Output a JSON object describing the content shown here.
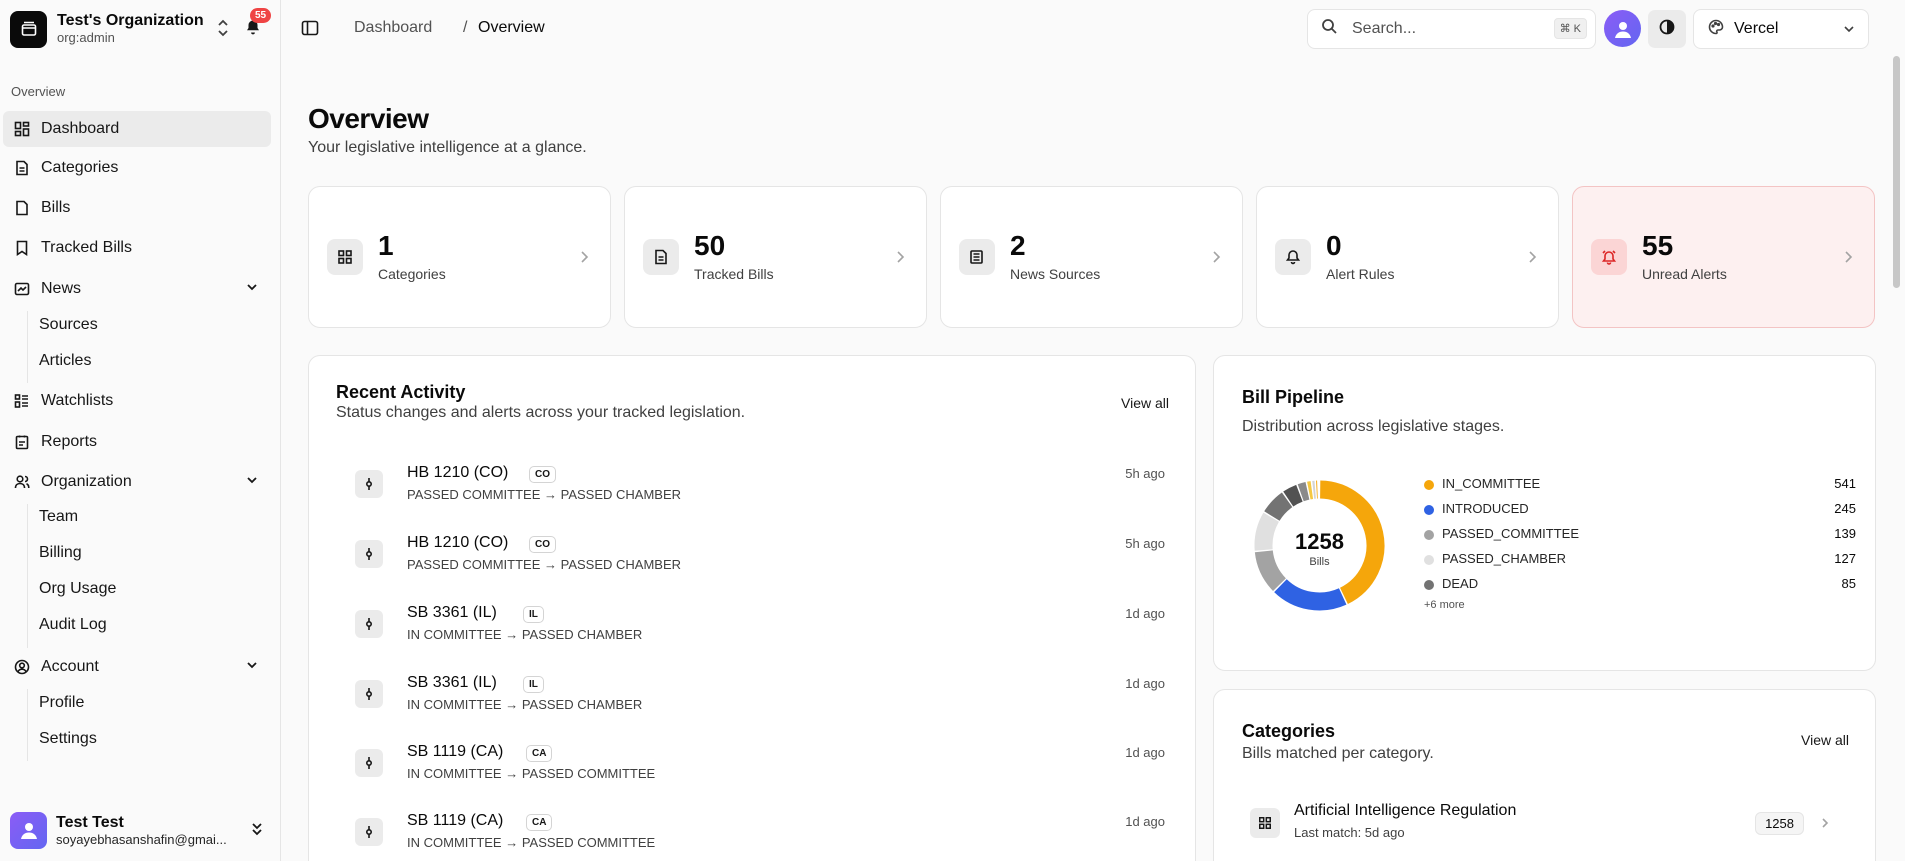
{
  "org": {
    "name": "Test's Organization",
    "role": "org:admin",
    "notifications": "55"
  },
  "sidebar": {
    "section": "Overview",
    "items": [
      {
        "label": "Dashboard",
        "icon": "dashboard-icon"
      },
      {
        "label": "Categories",
        "icon": "document-icon"
      },
      {
        "label": "Bills",
        "icon": "file-icon"
      },
      {
        "label": "Tracked Bills",
        "icon": "bookmark-icon"
      },
      {
        "label": "News",
        "icon": "newspaper-icon"
      },
      {
        "label": "Watchlists",
        "icon": "watchlist-icon"
      },
      {
        "label": "Reports",
        "icon": "report-icon"
      },
      {
        "label": "Organization",
        "icon": "users-icon"
      },
      {
        "label": "Account",
        "icon": "user-circle-icon"
      }
    ],
    "news_sub": [
      "Sources",
      "Articles"
    ],
    "org_sub": [
      "Team",
      "Billing",
      "Org Usage",
      "Audit Log"
    ],
    "account_sub": [
      "Profile",
      "Settings"
    ]
  },
  "user": {
    "name": "Test Test",
    "email": "soyayebhasanshafin@gmai..."
  },
  "header": {
    "breadcrumb": [
      "Dashboard",
      "Overview"
    ],
    "search_placeholder": "Search...",
    "shortcut": "⌘ K",
    "project": "Vercel"
  },
  "page": {
    "title": "Overview",
    "subtitle": "Your legislative intelligence at a glance."
  },
  "stats": [
    {
      "value": "1",
      "label": "Categories",
      "icon": "grid-icon"
    },
    {
      "value": "50",
      "label": "Tracked Bills",
      "icon": "document-icon"
    },
    {
      "value": "2",
      "label": "News Sources",
      "icon": "newspaper-icon"
    },
    {
      "value": "0",
      "label": "Alert Rules",
      "icon": "bell-icon"
    },
    {
      "value": "55",
      "label": "Unread Alerts",
      "icon": "alarm-icon"
    }
  ],
  "activity": {
    "title": "Recent Activity",
    "subtitle": "Status changes and alerts across your tracked legislation.",
    "view_all": "View all",
    "items": [
      {
        "title": "HB 1210 (CO)",
        "badge": "CO",
        "status": "PASSED COMMITTEE → PASSED CHAMBER",
        "time": "5h ago"
      },
      {
        "title": "HB 1210 (CO)",
        "badge": "CO",
        "status": "PASSED COMMITTEE → PASSED CHAMBER",
        "time": "5h ago"
      },
      {
        "title": "SB 3361 (IL)",
        "badge": "IL",
        "status": "IN COMMITTEE → PASSED CHAMBER",
        "time": "1d ago"
      },
      {
        "title": "SB 3361 (IL)",
        "badge": "IL",
        "status": "IN COMMITTEE → PASSED CHAMBER",
        "time": "1d ago"
      },
      {
        "title": "SB 1119 (CA)",
        "badge": "CA",
        "status": "IN COMMITTEE → PASSED COMMITTEE",
        "time": "1d ago"
      },
      {
        "title": "SB 1119 (CA)",
        "badge": "CA",
        "status": "IN COMMITTEE → PASSED COMMITTEE",
        "time": "1d ago"
      }
    ]
  },
  "pipeline": {
    "title": "Bill Pipeline",
    "subtitle": "Distribution across legislative stages.",
    "total": "1258",
    "total_label": "Bills",
    "more": "+6 more"
  },
  "chart_data": {
    "type": "pie",
    "variant": "donut",
    "center_value": 1258,
    "center_label": "Bills",
    "segments": [
      {
        "name": "IN_COMMITTEE",
        "value": 541,
        "color": "#f5a60b"
      },
      {
        "name": "INTRODUCED",
        "value": 245,
        "color": "#2f62e3"
      },
      {
        "name": "PASSED_COMMITTEE",
        "value": 139,
        "color": "#a3a3a3"
      },
      {
        "name": "PASSED_CHAMBER",
        "value": 127,
        "color": "#e0e0e0"
      },
      {
        "name": "DEAD",
        "value": 85,
        "color": "#737373"
      },
      {
        "value": 50,
        "color": "#525252"
      },
      {
        "value": 30,
        "color": "#8a8a8a"
      },
      {
        "value": 16,
        "color": "#f5c842"
      },
      {
        "value": 12,
        "color": "#d4d4d4"
      },
      {
        "value": 8,
        "color": "#f5a60b"
      },
      {
        "value": 5,
        "color": "#bdbdbd"
      }
    ],
    "legend_visible": 5
  },
  "categories": {
    "title": "Categories",
    "subtitle": "Bills matched per category.",
    "view_all": "View all",
    "items": [
      {
        "name": "Artificial Intelligence Regulation",
        "last": "Last match: 5d ago",
        "count": "1258"
      }
    ]
  }
}
